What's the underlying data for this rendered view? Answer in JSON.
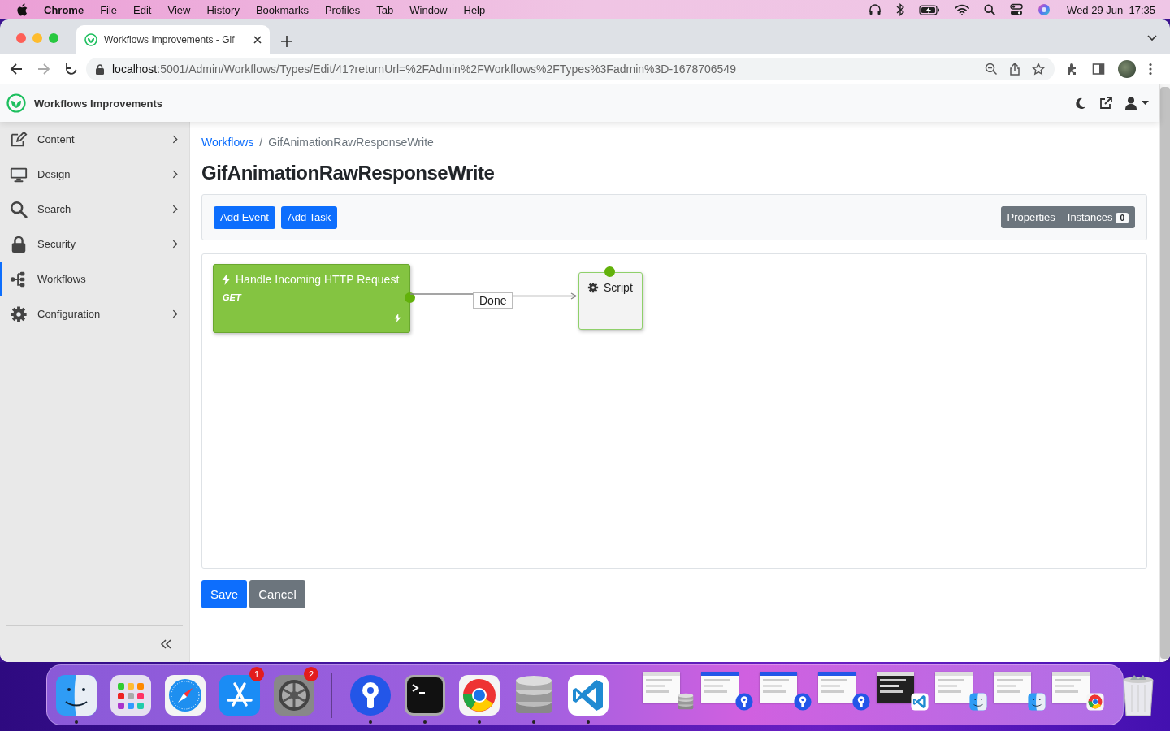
{
  "menubar": {
    "app": "Chrome",
    "menus": [
      "File",
      "Edit",
      "View",
      "History",
      "Bookmarks",
      "Profiles",
      "Tab",
      "Window",
      "Help"
    ],
    "clock": "Wed 29 Jun  17:35"
  },
  "browser": {
    "tabs": [
      {
        "title": "Workflows Improvements - Gif",
        "selected": true
      }
    ],
    "url_host": "localhost",
    "url_rest": ":5001/Admin/Workflows/Types/Edit/41?returnUrl=%2FAdmin%2FWorkflows%2FTypes%3Fadmin%3D-1678706549"
  },
  "header": {
    "brand": "Workflows Improvements"
  },
  "sidebar": {
    "items": [
      {
        "label": "Content",
        "expandable": true,
        "selected": false
      },
      {
        "label": "Design",
        "expandable": true,
        "selected": false
      },
      {
        "label": "Search",
        "expandable": true,
        "selected": false
      },
      {
        "label": "Security",
        "expandable": true,
        "selected": false
      },
      {
        "label": "Workflows",
        "expandable": false,
        "selected": true
      },
      {
        "label": "Configuration",
        "expandable": true,
        "selected": false
      }
    ]
  },
  "breadcrumb": [
    {
      "label": "Workflows",
      "kind": "link"
    },
    {
      "label": "/",
      "kind": "separator"
    },
    {
      "label": "GifAnimationRawResponseWrite",
      "kind": "current"
    }
  ],
  "title": "GifAnimationRawResponseWrite",
  "toolbar": {
    "buttons": [
      "Add Event",
      "Add Task"
    ],
    "properties": "Properties",
    "instances": {
      "label": "Instances",
      "count": "0"
    }
  },
  "diagram": {
    "activities": [
      {
        "kind": "event",
        "title": "Handle Incoming HTTP Request",
        "subtitle": "GET"
      },
      {
        "kind": "task",
        "title": "Script"
      }
    ],
    "connections": [
      {
        "label": "Done"
      }
    ]
  },
  "form_buttons": [
    {
      "label": "Save",
      "kind": "primary"
    },
    {
      "label": "Cancel",
      "kind": "secondary"
    }
  ],
  "dock": {
    "apps": [
      {
        "kind": "finder",
        "running": true
      },
      {
        "kind": "launchpad",
        "running": false
      },
      {
        "kind": "safari",
        "running": false
      },
      {
        "kind": "appstore",
        "running": false,
        "badge": "1"
      },
      {
        "kind": "settings",
        "running": false,
        "badge": "2"
      },
      {
        "kind": "sourcetree",
        "running": true
      },
      {
        "kind": "terminal",
        "running": true
      },
      {
        "kind": "chrome",
        "running": true
      },
      {
        "kind": "database",
        "running": true
      },
      {
        "kind": "vscode",
        "running": true
      }
    ],
    "windows": [
      {
        "kind": "database"
      },
      {
        "kind": "sourcetree"
      },
      {
        "kind": "sourcetree"
      },
      {
        "kind": "sourcetree"
      },
      {
        "kind": "vscode"
      },
      {
        "kind": "finder"
      },
      {
        "kind": "finder"
      },
      {
        "kind": "chrome"
      }
    ]
  }
}
